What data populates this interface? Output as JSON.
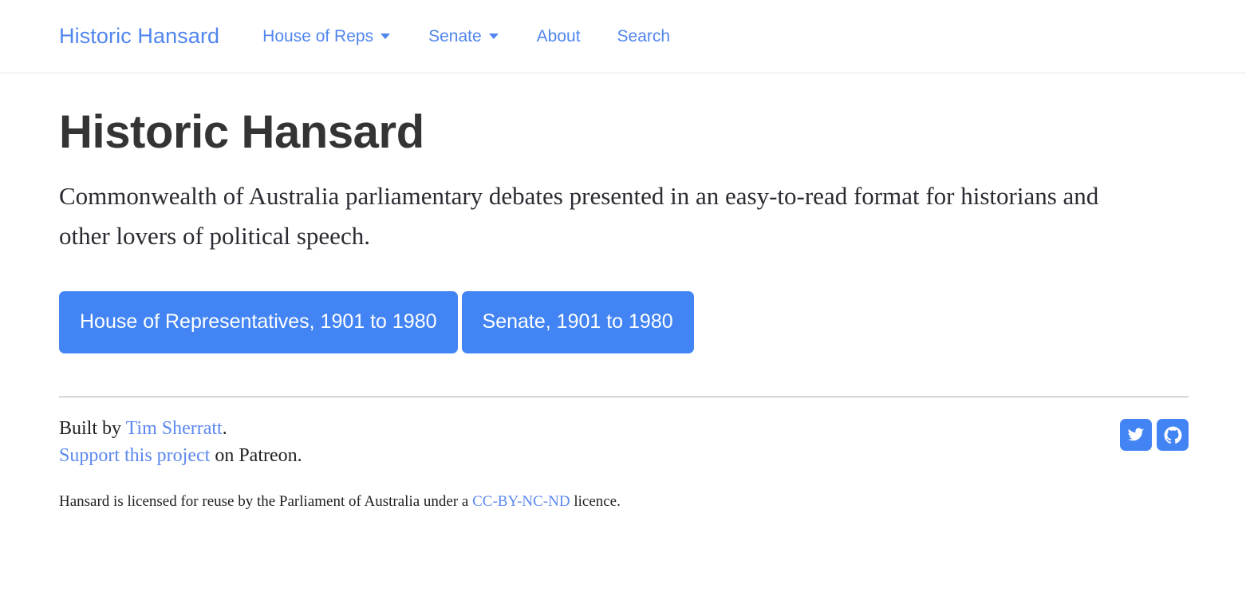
{
  "navbar": {
    "brand": "Historic Hansard",
    "items": [
      {
        "label": "House of Reps",
        "has_caret": true
      },
      {
        "label": "Senate",
        "has_caret": true
      },
      {
        "label": "About",
        "has_caret": false
      },
      {
        "label": "Search",
        "has_caret": false
      }
    ]
  },
  "main": {
    "title": "Historic Hansard",
    "lead": "Commonwealth of Australia parliamentary debates presented in an easy-to-read format for historians and other lovers of political speech.",
    "buttons": [
      {
        "label": "House of Representatives, 1901 to 1980"
      },
      {
        "label": "Senate, 1901 to 1980"
      }
    ]
  },
  "footer": {
    "built_by_prefix": "Built by ",
    "built_by_link": "Tim Sherratt",
    "built_by_suffix": ".",
    "support_link": "Support this project",
    "support_suffix": " on Patreon.",
    "licence_prefix": "Hansard is licensed for reuse by the Parliament of Australia under a ",
    "licence_link": "CC-BY-NC-ND",
    "licence_suffix": " licence.",
    "social": [
      {
        "name": "twitter-icon"
      },
      {
        "name": "github-icon"
      }
    ]
  },
  "colors": {
    "link": "#5186ee",
    "button": "#4284f4",
    "text": "#333333",
    "border": "#e7e7e7"
  }
}
